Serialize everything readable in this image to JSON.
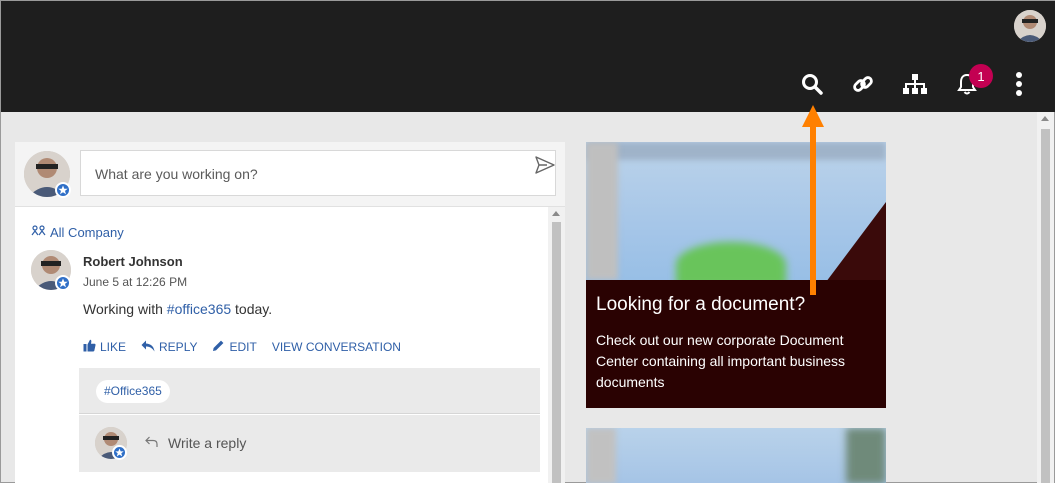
{
  "header": {
    "icons": [
      "search-icon",
      "link-icon",
      "sitemap-icon",
      "bell-icon",
      "more-icon"
    ],
    "notification_count": "1"
  },
  "composer": {
    "placeholder": "What are you working on?"
  },
  "post": {
    "group": "All Company",
    "author": "Robert Johnson",
    "time": "June 5 at 12:26 PM",
    "message_prefix": "Working with ",
    "message_tag": "#office365",
    "message_suffix": " today.",
    "actions": {
      "like": "LIKE",
      "reply": "REPLY",
      "edit": "EDIT",
      "view": "VIEW CONVERSATION"
    },
    "topic_chip": "#Office365",
    "reply_placeholder": "Write a reply"
  },
  "card": {
    "title": "Looking for a document?",
    "text": "Check out our new corporate Document Center containing all important business documents"
  },
  "colors": {
    "topbar": "#1e1e1e",
    "accent_link": "#2f5fa7",
    "badge": "#c30052",
    "annotation_arrow": "#ff8000",
    "card_bg": "#2a0202"
  }
}
